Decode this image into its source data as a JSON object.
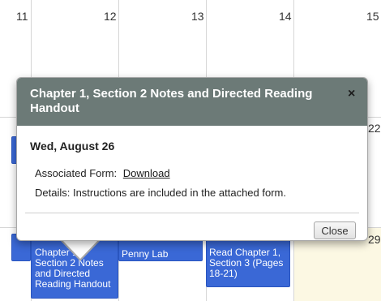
{
  "calendar": {
    "top_row_days": [
      "11",
      "12",
      "13",
      "14",
      "15"
    ],
    "mid_day": "22",
    "bottom_day": "29",
    "events": [
      {
        "label": "Chapter 1, Section 2 Notes and Directed Reading Handout"
      },
      {
        "label": "Penny Lab"
      },
      {
        "label": "Read Chapter 1, Section 3 (Pages 18-21)"
      }
    ],
    "event_color": "#3a68d6"
  },
  "popover": {
    "title": "Chapter 1, Section 2 Notes and Directed Reading Handout",
    "close_icon_glyph": "×",
    "date": "Wed, August 26",
    "associated_form_label": "Associated Form:",
    "associated_form_link": "Download",
    "details_text": "Details: Instructions are included in the attached form.",
    "close_button_label": "Close",
    "header_color": "#6c7a77"
  }
}
